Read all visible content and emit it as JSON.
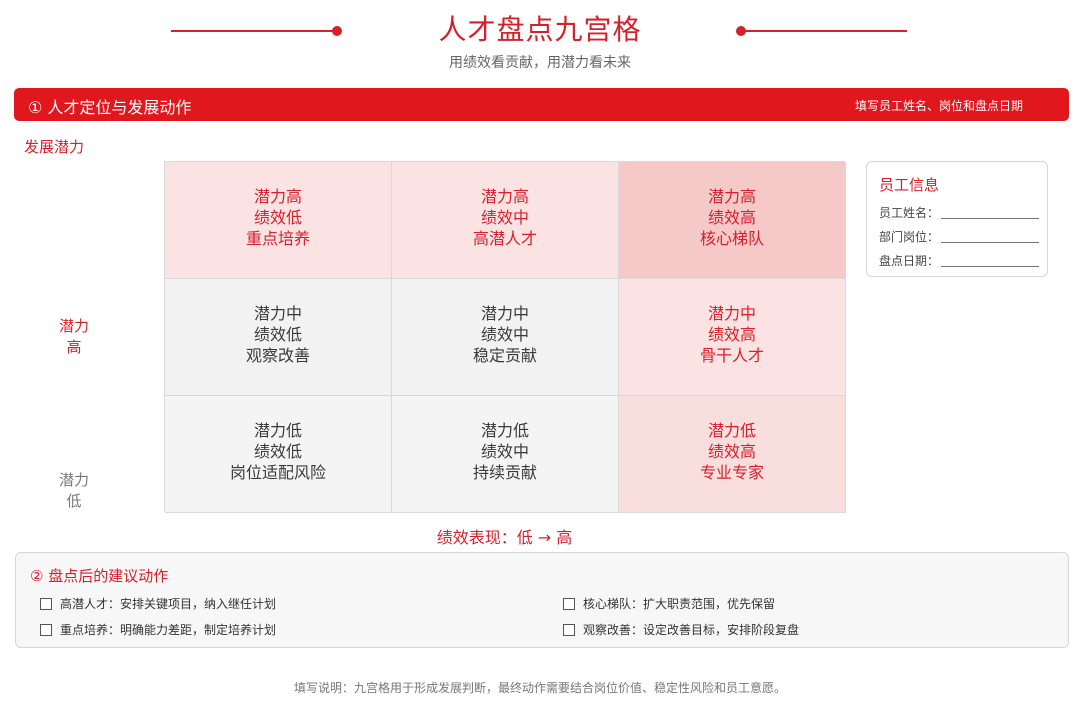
{
  "header": {
    "title": "人才盘点九宫格",
    "subtitle": "用绩效看贡献，用潜力看未来",
    "accent_color": "#d6202a"
  },
  "section1": {
    "title": "① 人才定位与发展动作",
    "hint": "填写员工姓名、岗位和盘点日期"
  },
  "axes": {
    "y_title": "发展潜力",
    "y_high": [
      "潜力",
      "高"
    ],
    "y_low": [
      "潜力",
      "低"
    ],
    "x_title": "绩效表现：低 → 高"
  },
  "grid": {
    "cells": [
      {
        "tone": "red",
        "bg": "#fbe3e3",
        "lines": [
          "潜力高",
          "绩效低",
          "重点培养"
        ]
      },
      {
        "tone": "red",
        "bg": "#fbe3e3",
        "lines": [
          "潜力高",
          "绩效中",
          "高潜人才"
        ]
      },
      {
        "tone": "red",
        "bg": "#f6c9c9",
        "lines": [
          "潜力高",
          "绩效高",
          "核心梯队"
        ]
      },
      {
        "tone": "gray",
        "bg": "#f2f2f2",
        "lines": [
          "潜力中",
          "绩效低",
          "观察改善"
        ]
      },
      {
        "tone": "gray",
        "bg": "#f2f2f2",
        "lines": [
          "潜力中",
          "绩效中",
          "稳定贡献"
        ]
      },
      {
        "tone": "red",
        "bg": "#fbe3e3",
        "lines": [
          "潜力中",
          "绩效高",
          "骨干人才"
        ]
      },
      {
        "tone": "gray",
        "bg": "#f4f4f4",
        "lines": [
          "潜力低",
          "绩效低",
          "岗位适配风险"
        ]
      },
      {
        "tone": "gray",
        "bg": "#f4f4f4",
        "lines": [
          "潜力低",
          "绩效中",
          "持续贡献"
        ]
      },
      {
        "tone": "red",
        "bg": "#f9dede",
        "lines": [
          "潜力低",
          "绩效高",
          "专业专家"
        ]
      }
    ]
  },
  "info_card": {
    "title": "员工信息",
    "fields": [
      "员工姓名：",
      "部门岗位：",
      "盘点日期："
    ]
  },
  "section2": {
    "title": "② 盘点后的建议动作",
    "items": [
      "高潜人才：安排关键项目，纳入继任计划",
      "核心梯队：扩大职责范围，优先保留",
      "重点培养：明确能力差距，制定培养计划",
      "观察改善：设定改善目标，安排阶段复盘"
    ]
  },
  "footnote": "填写说明：九宫格用于形成发展判断，最终动作需要结合岗位价值、稳定性风险和员工意愿。"
}
